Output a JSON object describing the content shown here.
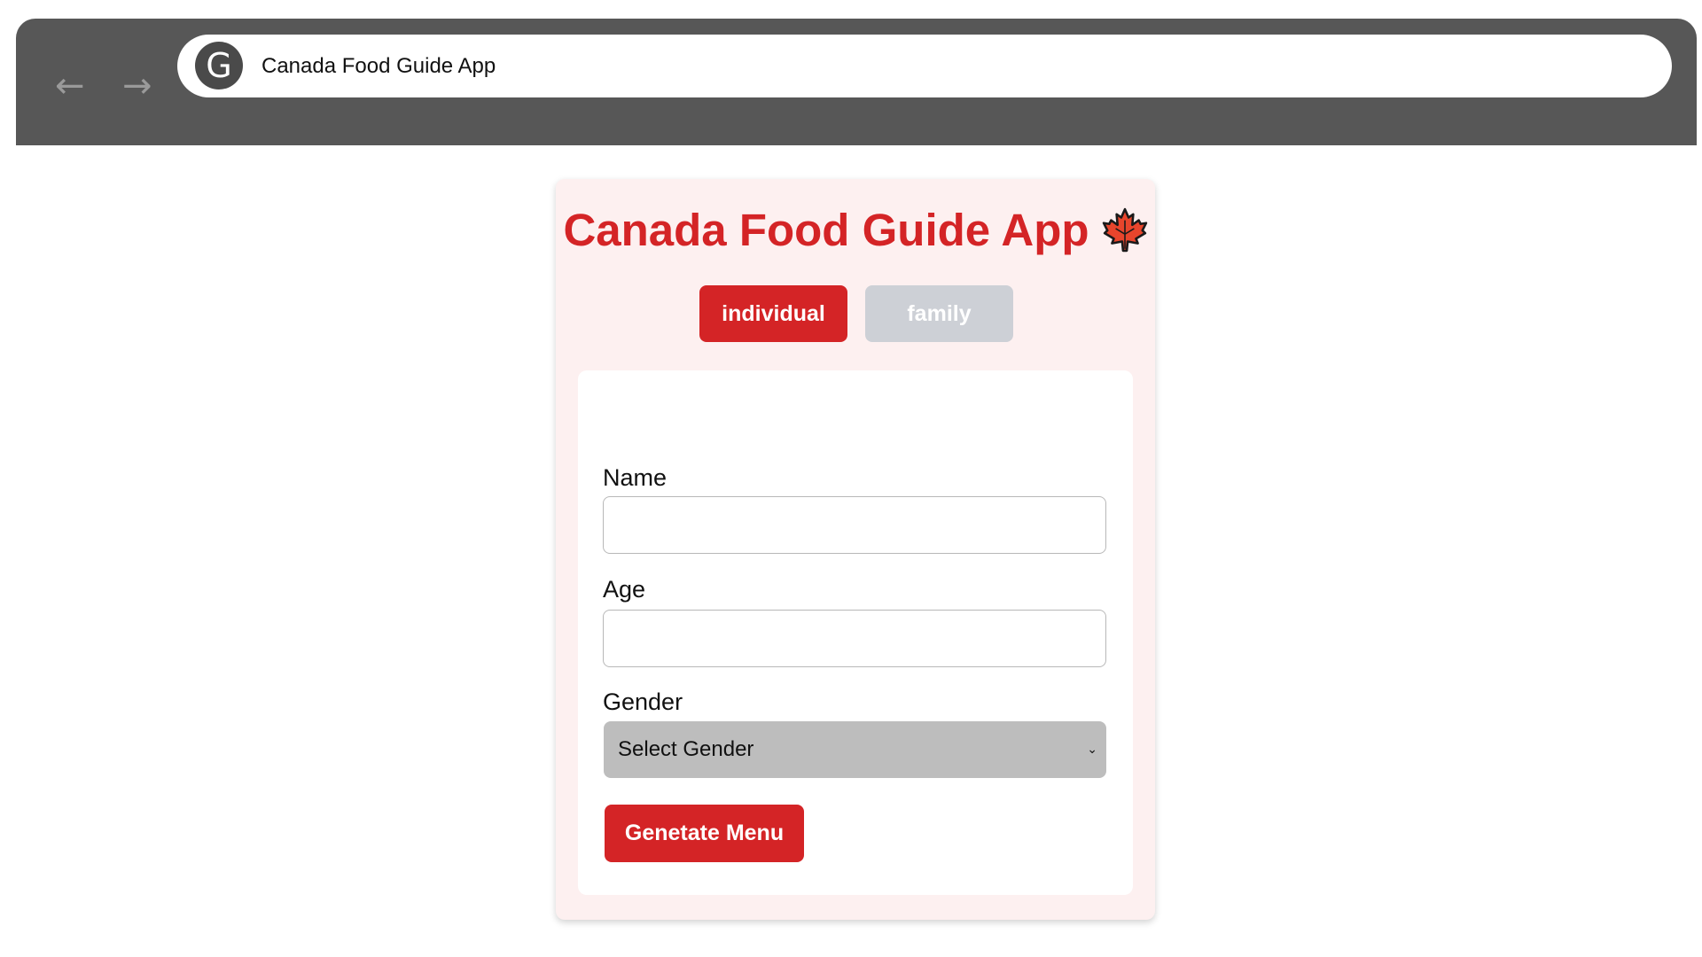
{
  "browser": {
    "back_icon": "←",
    "forward_icon": "→",
    "site_icon_letter": "G",
    "address": "Canada Food Guide App"
  },
  "app": {
    "title": "Canada Food Guide App",
    "title_icon": "maple-leaf-icon",
    "accent_color": "#d42426",
    "tabs": [
      {
        "label": "individual",
        "active": true
      },
      {
        "label": "family",
        "active": false
      }
    ]
  },
  "form": {
    "name_label": "Name",
    "name_value": "",
    "age_label": "Age",
    "age_value": "",
    "gender_label": "Gender",
    "gender_selected": "Select Gender",
    "submit_label": "Genetate Menu"
  }
}
